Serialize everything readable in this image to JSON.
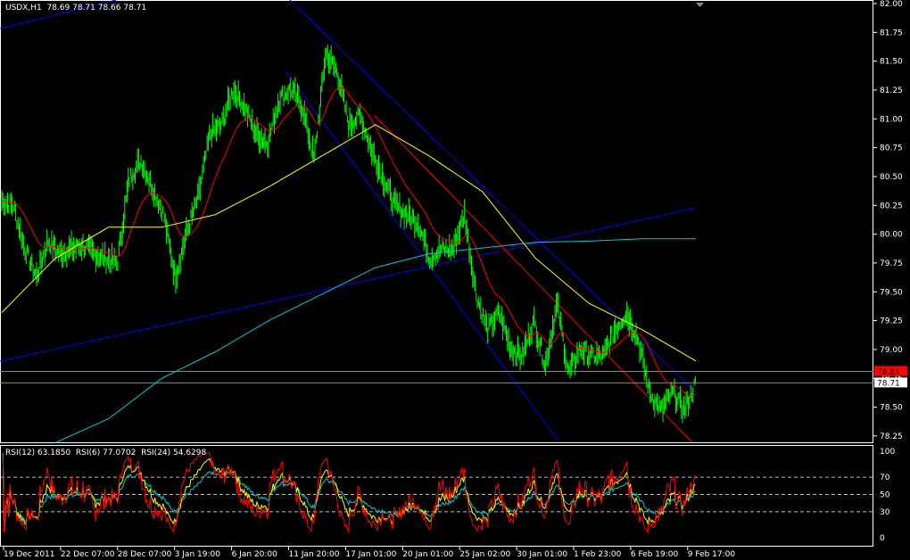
{
  "header": {
    "symbol_info": "USDX,H1  78.69 78.71 78.66 78.71"
  },
  "rsi_header": {
    "text": "RSI(12) 63.1850  RSI(6) 77.0702  RSI(24) 54.6298"
  },
  "colors": {
    "background": "#000000",
    "bars": "#00ff00",
    "ma_fast": "#ff0000",
    "ma_mid": "#ffff00",
    "ma_slow": "#00cccc",
    "trendlines": "#0000ff",
    "rsi12": "#ffff00",
    "rsi6": "#ff0000",
    "rsi24": "#00cccc",
    "bid_line": "#808a99",
    "ask_label": "#ff0000"
  },
  "chart_data": [
    {
      "type": "line",
      "title": "USDX,H1",
      "ylim": [
        78.2,
        82.0
      ],
      "y_ticks": [
        "82.00",
        "81.75",
        "81.50",
        "81.25",
        "81.00",
        "80.75",
        "80.50",
        "80.25",
        "80.00",
        "79.75",
        "79.50",
        "79.25",
        "79.00",
        "78.75",
        "78.50",
        "78.25"
      ],
      "x_ticks": [
        "19 Dec 2011",
        "22 Dec 07:00",
        "28 Dec 07:00",
        "3 Jan 19:00",
        "6 Jan 20:00",
        "11 Jan 20:00",
        "17 Jan 01:00",
        "20 Jan 01:00",
        "25 Jan 02:00",
        "30 Jan 01:00",
        "1 Feb 23:00",
        "6 Feb 19:00",
        "9 Feb 17:00"
      ],
      "price": [
        80.29,
        80.25,
        79.87,
        79.63,
        79.94,
        79.83,
        79.87,
        79.9,
        79.83,
        79.79,
        79.75,
        80.48,
        80.64,
        80.41,
        80.17,
        79.63,
        80.02,
        80.33,
        80.87,
        80.95,
        81.26,
        81.1,
        80.87,
        80.79,
        81.18,
        81.26,
        81.1,
        80.64,
        81.57,
        81.41,
        80.95,
        81.03,
        80.72,
        80.48,
        80.25,
        80.17,
        80.1,
        79.79,
        79.87,
        79.87,
        80.17,
        79.48,
        79.17,
        79.32,
        79.01,
        78.94,
        79.25,
        78.86,
        79.4,
        78.79,
        79.01,
        78.94,
        78.94,
        79.17,
        79.32,
        79.09,
        78.63,
        78.47,
        78.63,
        78.47,
        78.71
      ],
      "ma_mid": [
        79.32,
        79.79,
        80.06,
        80.06,
        80.17,
        80.41,
        80.68,
        80.95,
        80.68,
        80.37,
        79.79,
        79.4,
        79.17,
        78.9
      ],
      "ma_slow": [
        null,
        78.19,
        78.4,
        78.75,
        78.98,
        79.25,
        79.48,
        79.71,
        79.83,
        79.88,
        79.93,
        79.94,
        79.96,
        79.96
      ],
      "price_labels": {
        "ask": "78.81",
        "bid": "78.71"
      }
    },
    {
      "type": "line",
      "title": "RSI",
      "ylim": [
        0,
        100
      ],
      "y_ticks": [
        "100",
        "70",
        "50",
        "30",
        "0"
      ],
      "levels": [
        70,
        50,
        30
      ],
      "series": [
        {
          "name": "RSI(12)",
          "last": 63.185
        },
        {
          "name": "RSI(6)",
          "last": 77.0702
        },
        {
          "name": "RSI(24)",
          "last": 54.6298
        }
      ]
    }
  ]
}
